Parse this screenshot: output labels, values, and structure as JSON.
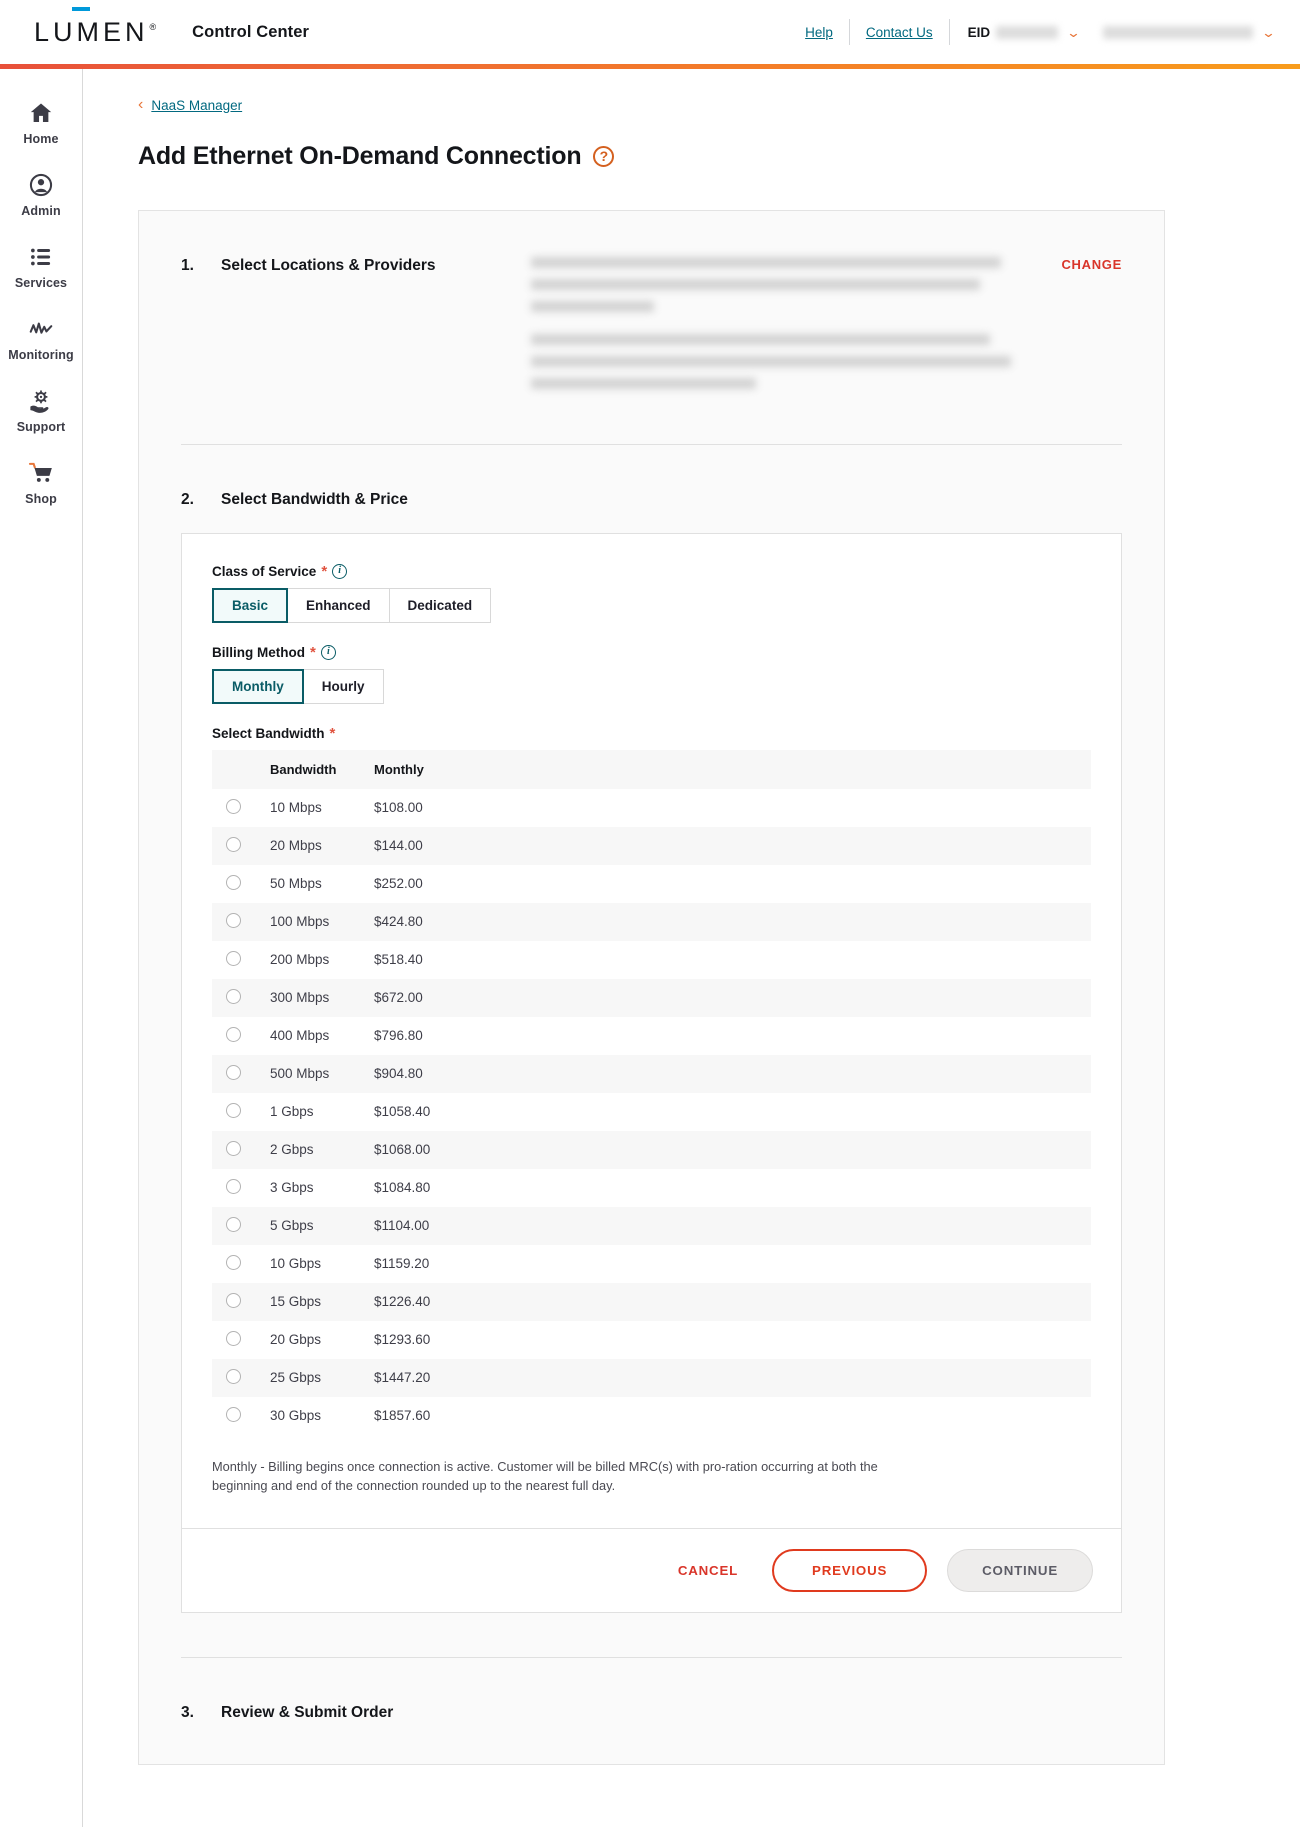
{
  "header": {
    "logo_text": "LUMEN",
    "logo_registered": "®",
    "app_title": "Control Center",
    "help_label": "Help",
    "contact_label": "Contact Us",
    "eid_label": "EID",
    "accent_color": "#f47e28"
  },
  "sidebar": {
    "items": [
      {
        "label": "Home",
        "icon": "home-icon"
      },
      {
        "label": "Admin",
        "icon": "user-circle-icon"
      },
      {
        "label": "Services",
        "icon": "list-icon"
      },
      {
        "label": "Monitoring",
        "icon": "activity-icon"
      },
      {
        "label": "Support",
        "icon": "gear-hand-icon"
      },
      {
        "label": "Shop",
        "icon": "shopping-cart-icon"
      }
    ]
  },
  "breadcrumb": {
    "back_label": "NaaS Manager"
  },
  "page": {
    "title": "Add Ethernet On-Demand Connection",
    "help_glyph": "?"
  },
  "steps": {
    "one": {
      "number": "1.",
      "title": "Select Locations & Providers",
      "change_label": "CHANGE"
    },
    "two": {
      "number": "2.",
      "title": "Select Bandwidth & Price"
    },
    "three": {
      "number": "3.",
      "title": "Review & Submit Order"
    }
  },
  "form": {
    "class_of_service": {
      "label": "Class of Service",
      "required_mark": "*",
      "info_glyph": "i",
      "options": [
        "Basic",
        "Enhanced",
        "Dedicated"
      ],
      "selected": "Basic"
    },
    "billing_method": {
      "label": "Billing Method",
      "required_mark": "*",
      "info_glyph": "i",
      "options": [
        "Monthly",
        "Hourly"
      ],
      "selected": "Monthly"
    },
    "select_bandwidth": {
      "label": "Select Bandwidth",
      "required_mark": "*"
    },
    "table": {
      "columns": [
        "",
        "Bandwidth",
        "Monthly"
      ],
      "rows": [
        {
          "bandwidth": "10 Mbps",
          "price": "$108.00",
          "selected": false
        },
        {
          "bandwidth": "20 Mbps",
          "price": "$144.00",
          "selected": false
        },
        {
          "bandwidth": "50 Mbps",
          "price": "$252.00",
          "selected": false
        },
        {
          "bandwidth": "100 Mbps",
          "price": "$424.80",
          "selected": false
        },
        {
          "bandwidth": "200 Mbps",
          "price": "$518.40",
          "selected": false
        },
        {
          "bandwidth": "300 Mbps",
          "price": "$672.00",
          "selected": false
        },
        {
          "bandwidth": "400 Mbps",
          "price": "$796.80",
          "selected": false
        },
        {
          "bandwidth": "500 Mbps",
          "price": "$904.80",
          "selected": false
        },
        {
          "bandwidth": "1 Gbps",
          "price": "$1058.40",
          "selected": false
        },
        {
          "bandwidth": "2 Gbps",
          "price": "$1068.00",
          "selected": false
        },
        {
          "bandwidth": "3 Gbps",
          "price": "$1084.80",
          "selected": false
        },
        {
          "bandwidth": "5 Gbps",
          "price": "$1104.00",
          "selected": false
        },
        {
          "bandwidth": "10 Gbps",
          "price": "$1159.20",
          "selected": false
        },
        {
          "bandwidth": "15 Gbps",
          "price": "$1226.40",
          "selected": false
        },
        {
          "bandwidth": "20 Gbps",
          "price": "$1293.60",
          "selected": false
        },
        {
          "bandwidth": "25 Gbps",
          "price": "$1447.20",
          "selected": false
        },
        {
          "bandwidth": "30 Gbps",
          "price": "$1857.60",
          "selected": false
        }
      ]
    },
    "note": "Monthly - Billing begins once connection is active. Customer will be billed MRC(s) with pro-ration occurring at both the beginning and end of the connection rounded up to the nearest full day."
  },
  "actions": {
    "cancel_label": "CANCEL",
    "previous_label": "PREVIOUS",
    "continue_label": "CONTINUE"
  }
}
